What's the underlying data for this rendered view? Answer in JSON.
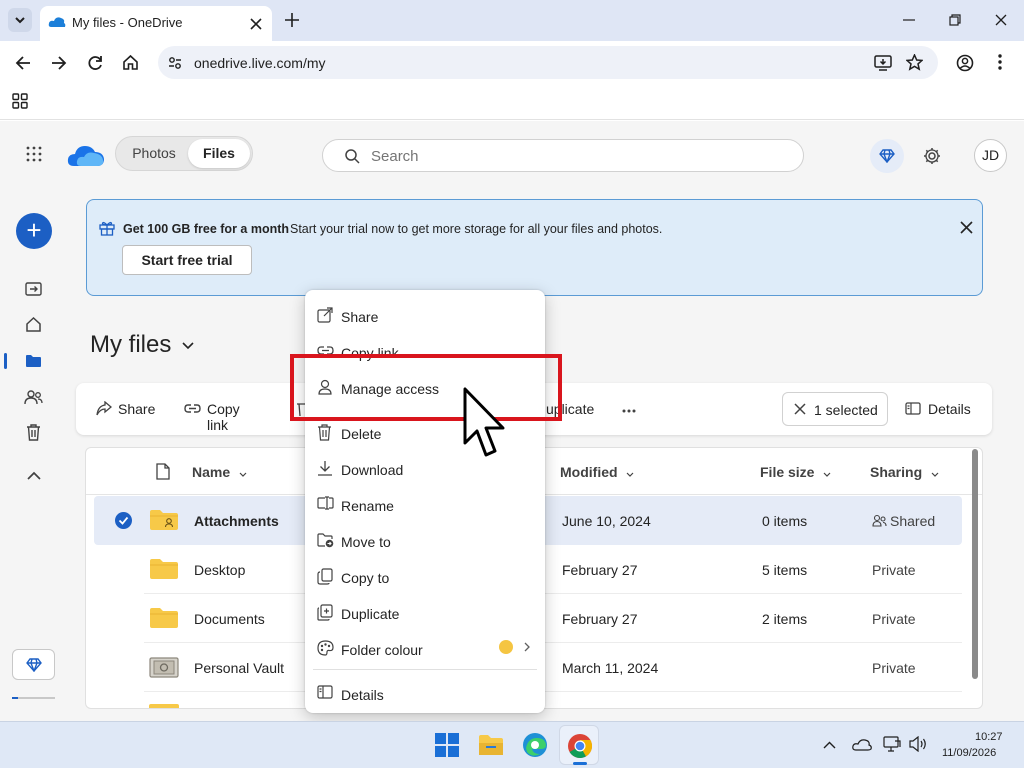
{
  "browser": {
    "tab_title": "My files - OneDrive",
    "url": "onedrive.live.com/my"
  },
  "app": {
    "segments": {
      "photos": "Photos",
      "files": "Files"
    },
    "search_placeholder": "Search",
    "avatar_initials": "JD",
    "accent_color": "#1c5fc4"
  },
  "banner": {
    "title": "Get 100 GB free for a month",
    "text": "Start your trial now to get more storage for all your files and photos.",
    "button": "Start free trial"
  },
  "page_title": "My files",
  "commandbar": {
    "share": "Share",
    "copy_link": "Copy link",
    "duplicate": "uplicate",
    "selected": "1 selected",
    "details": "Details"
  },
  "columns": {
    "name": "Name",
    "modified": "Modified",
    "file_size": "File size",
    "sharing": "Sharing"
  },
  "files": [
    {
      "name": "Attachments",
      "modified": "June 10, 2024",
      "size": "0 items",
      "sharing": "Shared",
      "selected": true,
      "type": "folder-shared"
    },
    {
      "name": "Desktop",
      "modified": "February 27",
      "size": "5 items",
      "sharing": "Private",
      "type": "folder"
    },
    {
      "name": "Documents",
      "modified": "February 27",
      "size": "2 items",
      "sharing": "Private",
      "type": "folder"
    },
    {
      "name": "Personal Vault",
      "modified": "March 11, 2024",
      "size": "",
      "sharing": "Private",
      "type": "vault"
    }
  ],
  "context_menu": {
    "items": [
      "Share",
      "Copy link",
      "Manage access",
      "Delete",
      "Download",
      "Rename",
      "Move to",
      "Copy to",
      "Duplicate",
      "Folder colour",
      "Details"
    ],
    "folder_colour_swatch": "#f5c542"
  },
  "taskbar": {
    "time": "10:27",
    "date": "11/09/2026"
  }
}
